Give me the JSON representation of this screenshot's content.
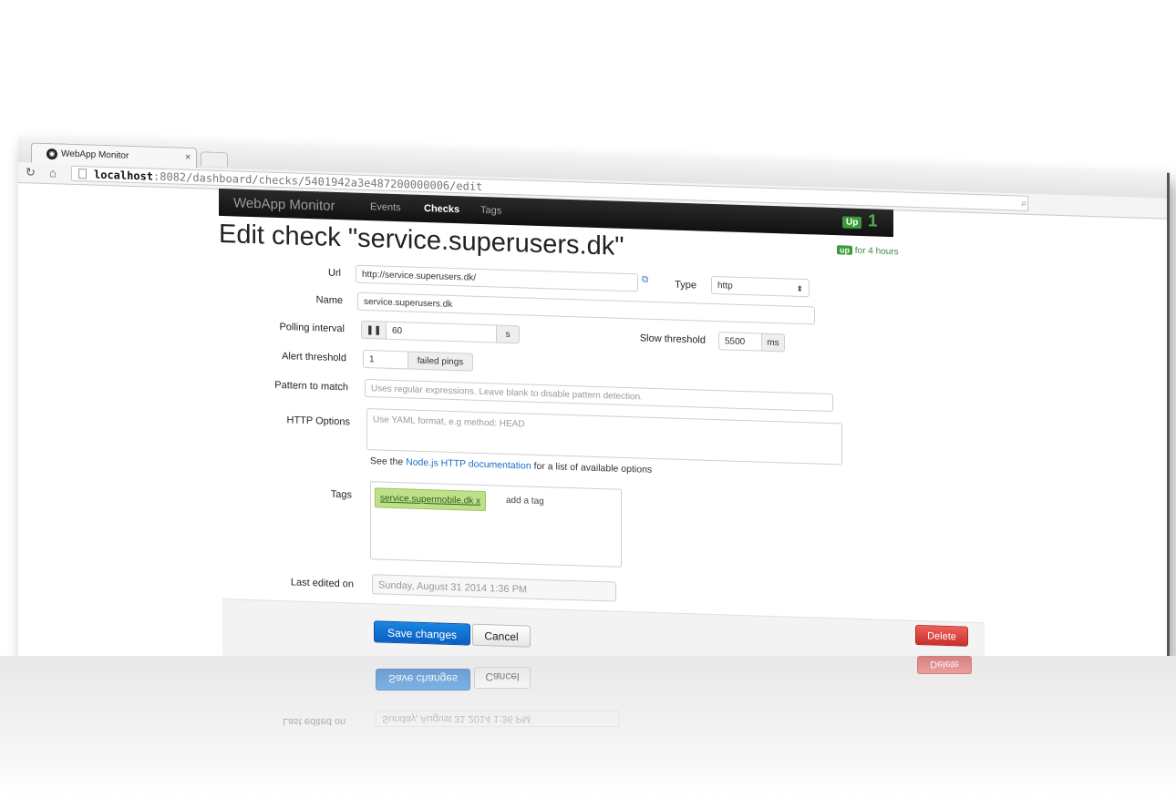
{
  "browser": {
    "tab_title": "WebApp Monitor",
    "tab_close": "×",
    "url_host": "localhost",
    "url_path": ":8082/dashboard/checks/5401942a3e487200000006/edit"
  },
  "navbar": {
    "brand": "WebApp Monitor",
    "links": [
      "Events",
      "Checks",
      "Tags"
    ],
    "active_link": "Checks",
    "up_label": "Up",
    "up_count": "1"
  },
  "page": {
    "title": "Edit check \"service.superusers.dk\"",
    "status_pill": "up",
    "status_text": "for 4 hours"
  },
  "form": {
    "url_label": "Url",
    "url_value": "http://service.superusers.dk/",
    "type_label": "Type",
    "type_value": "http",
    "name_label": "Name",
    "name_value": "service.superusers.dk",
    "polling_label": "Polling interval",
    "polling_value": "60",
    "polling_unit": "s",
    "slow_label": "Slow threshold",
    "slow_value": "5500",
    "slow_unit": "ms",
    "alert_label": "Alert threshold",
    "alert_value": "1",
    "alert_unit": "failed pings",
    "pattern_label": "Pattern to match",
    "pattern_placeholder": "Uses regular expressions. Leave blank to disable pattern detection.",
    "http_label": "HTTP Options",
    "http_placeholder": "Use YAML format, e.g method: HEAD",
    "http_help_prefix": "See the ",
    "http_help_link": "Node.js HTTP documentation",
    "http_help_suffix": " for a list of available options",
    "tags_label": "Tags",
    "tag_chip": "service.supermobile.dk",
    "tag_chip_remove": "x",
    "tag_add_placeholder": "add a tag",
    "last_edited_label": "Last edited on",
    "last_edited_value": "Sunday, August 31 2014 1:36 PM"
  },
  "actions": {
    "save": "Save changes",
    "cancel": "Cancel",
    "delete": "Delete"
  },
  "colors": {
    "primary": "#0b5fc2",
    "danger": "#c9302c",
    "up_green": "#3c9a3c",
    "navbar": "#111111"
  }
}
